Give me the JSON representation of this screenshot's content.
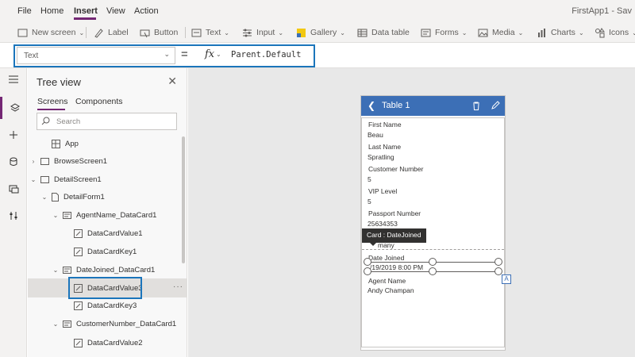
{
  "menu": {
    "items": [
      "File",
      "Home",
      "Insert",
      "View",
      "Action"
    ],
    "active": "Insert",
    "app_title": "FirstApp1 - Sav"
  },
  "ribbon": {
    "new_screen": "New screen",
    "label": "Label",
    "button": "Button",
    "text": "Text",
    "input": "Input",
    "gallery": "Gallery",
    "data_table": "Data table",
    "forms": "Forms",
    "media": "Media",
    "charts": "Charts",
    "icons": "Icons"
  },
  "formula_bar": {
    "property": "Text",
    "equals": "=",
    "fx": "fx",
    "formula": "Parent.Default"
  },
  "tree_view": {
    "title": "Tree view",
    "tabs": [
      "Screens",
      "Components"
    ],
    "search_placeholder": "Search",
    "nodes": {
      "app": "App",
      "browse_screen": "BrowseScreen1",
      "detail_screen": "DetailScreen1",
      "detail_form": "DetailForm1",
      "agent_card": "AgentName_DataCard1",
      "agent_value": "DataCardValue1",
      "agent_key": "DataCardKey1",
      "datejoined_card": "DateJoined_DataCard1",
      "datejoined_value": "DataCardValue3",
      "datejoined_key": "DataCardKey3",
      "customer_card": "CustomerNumber_DataCard1",
      "customer_value": "DataCardValue2"
    },
    "more": "···"
  },
  "app_screen": {
    "header_title": "Table 1",
    "fields": [
      {
        "label": "First Name",
        "value": "Beau"
      },
      {
        "label": "Last Name",
        "value": "Spratling"
      },
      {
        "label": "Customer Number",
        "value": "5"
      },
      {
        "label": "VIP Level",
        "value": "5"
      },
      {
        "label": "Passport Number",
        "value": "25634353"
      },
      {
        "label": "",
        "value": "many"
      },
      {
        "label": "Date Joined",
        "value": "/19/2019 8:00 PM"
      },
      {
        "label": "Agent Name",
        "value": "Andy Champan"
      }
    ],
    "tooltip": "Card : DateJoined",
    "badge": "A"
  },
  "colors": {
    "accent": "#742774",
    "header_blue": "#3c6fb6",
    "highlight": "#1b75bb"
  }
}
